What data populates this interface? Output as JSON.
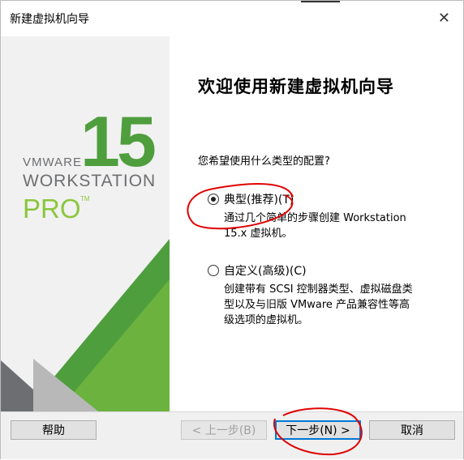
{
  "window": {
    "title": "新建虚拟机向导",
    "close_glyph": "✕"
  },
  "brand": {
    "vmware": "VMWARE",
    "workstation": "WORKSTATION",
    "pro": "PRO",
    "tm": "TM",
    "version": "15",
    "colors": {
      "green": "#4f9e3d",
      "dark_green": "#2e7d32",
      "gray": "#6d6e71",
      "light_green": "#8cc63f"
    }
  },
  "content": {
    "heading": "欢迎使用新建虚拟机向导",
    "question": "您希望使用什么类型的配置?",
    "options": [
      {
        "label": "典型(推荐)(T)",
        "selected": true,
        "description": [
          "通过几个简单的步骤创建 Workstation",
          "15.x 虚拟机。"
        ]
      },
      {
        "label": "自定义(高级)(C)",
        "selected": false,
        "description": [
          "创建带有 SCSI 控制器类型、虚拟磁盘类",
          "型以及与旧版 VMware 产品兼容性等高",
          "级选项的虚拟机。"
        ]
      }
    ]
  },
  "buttons": {
    "help": "帮助",
    "back": "< 上一步(B)",
    "next": "下一步(N) >",
    "cancel": "取消"
  },
  "annotation_color": "#e00000"
}
